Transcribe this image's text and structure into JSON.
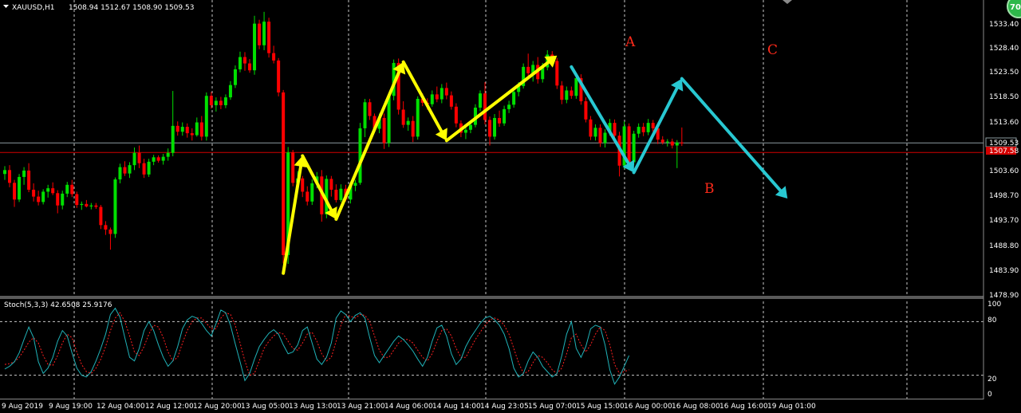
{
  "main_panel": {
    "symbol": "XAUUSD,H1",
    "ohlc": "1508.94 1512.67 1508.90 1509.53",
    "price_labels": [
      "1533.40",
      "1528.40",
      "1523.50",
      "1518.50",
      "1513.60",
      "1503.60",
      "1498.70",
      "1493.70",
      "1488.80",
      "1483.90",
      "1478.90"
    ],
    "current_price": "1509.53",
    "line_price": "1507.58",
    "wave_labels": {
      "a": "A",
      "b": "B",
      "c": "C"
    },
    "badge": "70"
  },
  "stoch_panel": {
    "title": "Stoch(5,3,3) 42.6508 25.9176",
    "levels": [
      "100",
      "80",
      "20",
      "0"
    ]
  },
  "time_axis": {
    "labels": [
      "9 Aug 2019",
      "9 Aug 19:00",
      "12 Aug 04:00",
      "12 Aug 12:00",
      "12 Aug 20:00",
      "13 Aug 05:00",
      "13 Aug 13:00",
      "13 Aug 21:00",
      "14 Aug 06:00",
      "14 Aug 14:00",
      "14 Aug 23:05",
      "15 Aug 07:00",
      "15 Aug 15:00",
      "16 Aug 00:00",
      "16 Aug 08:00",
      "16 Aug 16:00",
      "19 Aug 01:00"
    ]
  },
  "chart_data": {
    "type": "candlestick",
    "instrument": "XAUUSD",
    "timeframe": "H1",
    "ylim": [
      1478.9,
      1536.5
    ],
    "bull_color": "#00e000",
    "bear_color": "#ff0000",
    "candles": [
      [
        1503.2,
        1504.8,
        1502.0,
        1504.0
      ],
      [
        1504.0,
        1505.0,
        1500.5,
        1501.4
      ],
      [
        1501.4,
        1502.0,
        1496.5,
        1498.0
      ],
      [
        1498.0,
        1503.2,
        1497.5,
        1502.6
      ],
      [
        1502.6,
        1504.6,
        1501.0,
        1503.9
      ],
      [
        1503.9,
        1505.4,
        1499.5,
        1500.0
      ],
      [
        1500.0,
        1501.3,
        1497.6,
        1498.6
      ],
      [
        1498.6,
        1499.8,
        1496.8,
        1497.5
      ],
      [
        1497.5,
        1500.1,
        1497.0,
        1499.6
      ],
      [
        1499.6,
        1501.0,
        1498.4,
        1500.3
      ],
      [
        1500.3,
        1501.5,
        1498.9,
        1499.3
      ],
      [
        1499.3,
        1499.9,
        1495.2,
        1496.8
      ],
      [
        1496.8,
        1499.8,
        1496.0,
        1499.2
      ],
      [
        1499.2,
        1501.6,
        1498.5,
        1501.0
      ],
      [
        1501.0,
        1502.0,
        1498.5,
        1499.1
      ],
      [
        1499.1,
        1499.6,
        1496.3,
        1496.9
      ],
      [
        1496.9,
        1497.6,
        1495.9,
        1497.1
      ],
      [
        1497.1,
        1497.9,
        1496.4,
        1496.6
      ],
      [
        1496.6,
        1497.3,
        1496.0,
        1496.8
      ],
      [
        1496.8,
        1497.3,
        1496.1,
        1496.5
      ],
      [
        1496.5,
        1496.9,
        1492.0,
        1492.8
      ],
      [
        1492.8,
        1493.6,
        1490.8,
        1491.9
      ],
      [
        1491.9,
        1492.3,
        1487.8,
        1491.0
      ],
      [
        1491.0,
        1502.5,
        1490.2,
        1502.1
      ],
      [
        1502.1,
        1505.3,
        1501.3,
        1504.6
      ],
      [
        1504.6,
        1505.8,
        1502.8,
        1503.3
      ],
      [
        1503.3,
        1505.6,
        1502.4,
        1505.0
      ],
      [
        1505.0,
        1508.6,
        1504.0,
        1507.5
      ],
      [
        1507.5,
        1509.0,
        1504.4,
        1505.4
      ],
      [
        1505.4,
        1506.3,
        1502.4,
        1503.1
      ],
      [
        1503.1,
        1506.3,
        1502.6,
        1505.7
      ],
      [
        1505.7,
        1507.1,
        1505.0,
        1506.6
      ],
      [
        1506.6,
        1507.0,
        1505.5,
        1505.9
      ],
      [
        1505.9,
        1507.3,
        1505.1,
        1506.7
      ],
      [
        1506.7,
        1508.4,
        1505.9,
        1507.5
      ],
      [
        1507.5,
        1520.1,
        1506.8,
        1513.0
      ],
      [
        1513.0,
        1513.9,
        1511.0,
        1511.8
      ],
      [
        1511.8,
        1513.7,
        1511.0,
        1512.8
      ],
      [
        1512.8,
        1513.5,
        1510.6,
        1511.5
      ],
      [
        1511.5,
        1512.5,
        1510.0,
        1511.1
      ],
      [
        1511.1,
        1514.7,
        1510.8,
        1513.7
      ],
      [
        1513.7,
        1515.0,
        1510.0,
        1510.8
      ],
      [
        1510.8,
        1519.8,
        1510.0,
        1519.1
      ],
      [
        1519.1,
        1519.9,
        1516.5,
        1517.2
      ],
      [
        1517.2,
        1518.8,
        1515.9,
        1518.1
      ],
      [
        1518.1,
        1518.9,
        1516.4,
        1517.2
      ],
      [
        1517.2,
        1519.4,
        1516.6,
        1518.8
      ],
      [
        1518.8,
        1522.1,
        1518.3,
        1521.3
      ],
      [
        1521.3,
        1525.3,
        1520.7,
        1524.5
      ],
      [
        1524.5,
        1528.1,
        1523.9,
        1527.0
      ],
      [
        1527.0,
        1528.0,
        1524.2,
        1525.7
      ],
      [
        1525.7,
        1526.6,
        1523.8,
        1524.3
      ],
      [
        1524.3,
        1535.4,
        1523.4,
        1533.8
      ],
      [
        1533.8,
        1534.6,
        1528.6,
        1529.4
      ],
      [
        1529.4,
        1536.2,
        1528.4,
        1534.2
      ],
      [
        1534.2,
        1535.0,
        1526.9,
        1527.8
      ],
      [
        1527.8,
        1529.3,
        1525.7,
        1526.3
      ],
      [
        1526.3,
        1526.8,
        1519.0,
        1519.8
      ],
      [
        1519.8,
        1520.3,
        1485.0,
        1486.7
      ],
      [
        1486.7,
        1508.7,
        1484.9,
        1507.6
      ],
      [
        1507.6,
        1508.1,
        1500.7,
        1501.4
      ],
      [
        1501.4,
        1503.8,
        1500.0,
        1502.3
      ],
      [
        1502.3,
        1502.8,
        1498.5,
        1499.6
      ],
      [
        1499.6,
        1500.7,
        1496.8,
        1497.6
      ],
      [
        1497.6,
        1502.1,
        1496.9,
        1501.3
      ],
      [
        1501.3,
        1503.6,
        1500.3,
        1502.7
      ],
      [
        1502.7,
        1504.0,
        1493.5,
        1495.0
      ],
      [
        1495.0,
        1502.9,
        1494.2,
        1502.2
      ],
      [
        1502.2,
        1502.8,
        1498.6,
        1500.0
      ],
      [
        1500.0,
        1501.1,
        1497.4,
        1497.9
      ],
      [
        1497.9,
        1501.1,
        1497.5,
        1500.2
      ],
      [
        1500.2,
        1501.0,
        1497.6,
        1498.0
      ],
      [
        1498.0,
        1501.6,
        1497.2,
        1500.8
      ],
      [
        1500.8,
        1502.0,
        1499.7,
        1501.4
      ],
      [
        1501.4,
        1513.6,
        1501.0,
        1512.5
      ],
      [
        1512.5,
        1518.5,
        1510.7,
        1517.8
      ],
      [
        1517.8,
        1518.5,
        1514.2,
        1515.0
      ],
      [
        1515.0,
        1515.5,
        1511.7,
        1512.4
      ],
      [
        1512.4,
        1515.5,
        1511.5,
        1514.6
      ],
      [
        1514.6,
        1515.5,
        1508.3,
        1509.5
      ],
      [
        1509.5,
        1519.8,
        1508.7,
        1519.1
      ],
      [
        1519.1,
        1526.5,
        1518.2,
        1525.8
      ],
      [
        1525.8,
        1526.7,
        1515.3,
        1516.3
      ],
      [
        1516.3,
        1518.0,
        1512.6,
        1513.2
      ],
      [
        1513.2,
        1514.7,
        1512.0,
        1514.0
      ],
      [
        1514.0,
        1515.0,
        1509.7,
        1510.8
      ],
      [
        1510.8,
        1519.0,
        1510.2,
        1518.5
      ],
      [
        1518.5,
        1519.6,
        1517.0,
        1517.7
      ],
      [
        1517.7,
        1518.6,
        1516.3,
        1517.4
      ],
      [
        1517.4,
        1520.2,
        1516.9,
        1519.4
      ],
      [
        1519.4,
        1521.0,
        1517.8,
        1518.4
      ],
      [
        1518.4,
        1521.5,
        1517.6,
        1520.7
      ],
      [
        1520.7,
        1521.8,
        1518.4,
        1519.2
      ],
      [
        1519.2,
        1520.0,
        1516.3,
        1516.9
      ],
      [
        1516.9,
        1517.6,
        1512.7,
        1513.5
      ],
      [
        1513.5,
        1514.1,
        1510.7,
        1511.6
      ],
      [
        1511.6,
        1512.8,
        1510.3,
        1512.2
      ],
      [
        1512.2,
        1514.0,
        1511.5,
        1513.2
      ],
      [
        1513.2,
        1517.4,
        1512.7,
        1516.7
      ],
      [
        1516.7,
        1520.2,
        1516.0,
        1519.6
      ],
      [
        1519.6,
        1521.9,
        1513.3,
        1514.2
      ],
      [
        1514.2,
        1514.9,
        1509.0,
        1510.8
      ],
      [
        1510.8,
        1515.4,
        1510.2,
        1514.6
      ],
      [
        1514.6,
        1516.1,
        1512.8,
        1513.5
      ],
      [
        1513.5,
        1517.1,
        1513.0,
        1516.4
      ],
      [
        1516.4,
        1518.1,
        1515.6,
        1517.3
      ],
      [
        1517.3,
        1520.6,
        1516.7,
        1519.9
      ],
      [
        1519.9,
        1521.9,
        1519.0,
        1521.1
      ],
      [
        1521.1,
        1525.7,
        1520.6,
        1525.0
      ],
      [
        1525.0,
        1527.7,
        1522.9,
        1523.7
      ],
      [
        1523.7,
        1526.2,
        1522.0,
        1525.4
      ],
      [
        1525.4,
        1527.0,
        1521.6,
        1522.5
      ],
      [
        1522.5,
        1525.8,
        1521.8,
        1524.9
      ],
      [
        1524.9,
        1528.4,
        1524.3,
        1527.5
      ],
      [
        1527.5,
        1528.2,
        1525.4,
        1526.2
      ],
      [
        1526.2,
        1526.8,
        1520.5,
        1521.2
      ],
      [
        1521.2,
        1522.1,
        1517.4,
        1518.3
      ],
      [
        1518.3,
        1521.0,
        1517.6,
        1520.2
      ],
      [
        1520.2,
        1521.0,
        1518.5,
        1519.1
      ],
      [
        1519.1,
        1523.5,
        1518.5,
        1522.7
      ],
      [
        1522.7,
        1523.5,
        1517.3,
        1518.0
      ],
      [
        1518.0,
        1518.8,
        1513.7,
        1514.3
      ],
      [
        1514.3,
        1515.0,
        1510.1,
        1510.8
      ],
      [
        1510.8,
        1513.3,
        1510.0,
        1512.6
      ],
      [
        1512.6,
        1513.3,
        1508.7,
        1509.5
      ],
      [
        1509.5,
        1512.3,
        1508.6,
        1511.6
      ],
      [
        1511.6,
        1514.4,
        1511.0,
        1513.6
      ],
      [
        1513.6,
        1514.3,
        1510.2,
        1511.0
      ],
      [
        1511.0,
        1511.8,
        1502.7,
        1504.9
      ],
      [
        1504.9,
        1513.9,
        1504.3,
        1512.9
      ],
      [
        1512.9,
        1513.5,
        1504.7,
        1505.6
      ],
      [
        1505.6,
        1512.0,
        1505.0,
        1511.4
      ],
      [
        1511.4,
        1513.5,
        1510.6,
        1512.8
      ],
      [
        1512.8,
        1513.6,
        1510.9,
        1511.7
      ],
      [
        1511.7,
        1514.4,
        1511.1,
        1513.6
      ],
      [
        1513.6,
        1514.2,
        1511.8,
        1512.5
      ],
      [
        1512.5,
        1513.3,
        1509.3,
        1510.2
      ],
      [
        1510.2,
        1510.9,
        1509.2,
        1509.6
      ],
      [
        1509.6,
        1510.3,
        1508.8,
        1509.8
      ],
      [
        1509.8,
        1510.4,
        1508.4,
        1509.0
      ],
      [
        1509.0,
        1510.1,
        1504.4,
        1509.6
      ],
      [
        1509.6,
        1512.67,
        1508.9,
        1509.53
      ]
    ],
    "horizontal_lines": [
      {
        "name": "current",
        "value": 1509.53,
        "color": "#8c9ba0"
      },
      {
        "name": "level",
        "value": 1507.58,
        "color": "#d30000"
      }
    ],
    "wave_arrows": [
      {
        "color": "#ffff00",
        "points": [
          [
            58,
            1483.0
          ],
          [
            62,
            1506.9
          ],
          [
            69,
            1494.0
          ],
          [
            83,
            1526.0
          ],
          [
            92,
            1510.0
          ],
          [
            115,
            1527.3
          ]
        ]
      },
      {
        "color": "#28c8d2",
        "points": [
          [
            118,
            1525.0
          ],
          [
            131,
            1503.5
          ],
          [
            141,
            1522.6
          ],
          [
            163,
            1498.2
          ]
        ]
      }
    ],
    "stochastic": {
      "name": "Stoch(5,3,3)",
      "k_last": 42.6508,
      "d_last": 25.9176,
      "ylim": [
        0,
        100
      ],
      "levels": [
        80,
        20
      ],
      "k": [
        27,
        30,
        35,
        45,
        60,
        74,
        62,
        35,
        22,
        28,
        40,
        58,
        70,
        64,
        45,
        28,
        20,
        18,
        24,
        36,
        50,
        66,
        88,
        95,
        85,
        62,
        40,
        36,
        50,
        70,
        80,
        70,
        54,
        40,
        30,
        36,
        52,
        72,
        82,
        86,
        84,
        78,
        70,
        64,
        78,
        93,
        90,
        76,
        55,
        35,
        14,
        22,
        38,
        52,
        60,
        67,
        71,
        66,
        54,
        44,
        46,
        54,
        70,
        74,
        56,
        38,
        32,
        40,
        56,
        84,
        92,
        88,
        80,
        87,
        90,
        84,
        62,
        42,
        34,
        42,
        50,
        58,
        64,
        60,
        54,
        47,
        38,
        30,
        40,
        58,
        73,
        76,
        64,
        44,
        32,
        38,
        52,
        62,
        70,
        78,
        84,
        86,
        82,
        76,
        66,
        50,
        28,
        18,
        22,
        36,
        46,
        40,
        30,
        24,
        18,
        22,
        42,
        66,
        80,
        50,
        40,
        52,
        72,
        76,
        74,
        54,
        26,
        10,
        18,
        30,
        42
      ],
      "d": [
        32,
        33,
        35,
        40,
        48,
        57,
        62,
        56,
        42,
        32,
        31,
        42,
        56,
        66,
        62,
        46,
        32,
        24,
        22,
        28,
        38,
        52,
        70,
        84,
        90,
        80,
        64,
        46,
        42,
        52,
        66,
        76,
        74,
        62,
        46,
        36,
        40,
        56,
        70,
        80,
        84,
        84,
        78,
        72,
        72,
        84,
        90,
        88,
        76,
        56,
        36,
        20,
        22,
        36,
        50,
        58,
        64,
        68,
        66,
        58,
        50,
        48,
        56,
        66,
        68,
        58,
        44,
        36,
        40,
        58,
        76,
        88,
        86,
        84,
        88,
        87,
        80,
        64,
        48,
        40,
        40,
        48,
        56,
        60,
        60,
        56,
        48,
        40,
        36,
        44,
        58,
        70,
        72,
        64,
        50,
        40,
        40,
        50,
        60,
        68,
        76,
        82,
        84,
        82,
        76,
        66,
        50,
        34,
        22,
        24,
        34,
        42,
        40,
        34,
        26,
        22,
        28,
        44,
        62,
        66,
        54,
        46,
        54,
        66,
        74,
        70,
        54,
        32,
        22,
        24,
        26
      ]
    }
  }
}
